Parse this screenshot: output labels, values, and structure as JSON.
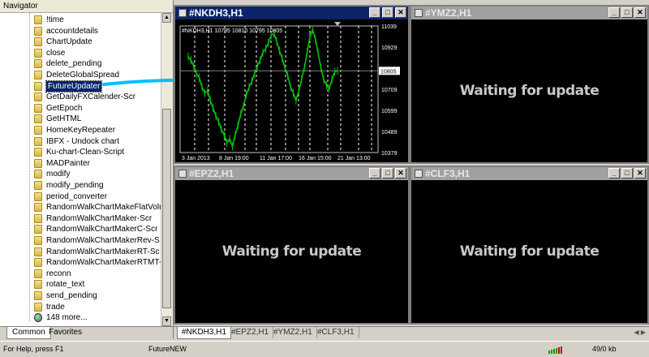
{
  "navigator": {
    "title": "Navigator",
    "items": [
      {
        "label": "!time",
        "icon": "script-icon"
      },
      {
        "label": "accountdetails",
        "icon": "script-icon"
      },
      {
        "label": "ChartUpdate",
        "icon": "script-icon"
      },
      {
        "label": "close",
        "icon": "script-icon"
      },
      {
        "label": "delete_pending",
        "icon": "script-icon"
      },
      {
        "label": "DeleteGlobalSpread",
        "icon": "script-icon"
      },
      {
        "label": "FutureUpdater",
        "icon": "script-icon",
        "selected": true
      },
      {
        "label": "GetDailyFXCalender-Scr",
        "icon": "script-icon"
      },
      {
        "label": "GetEpoch",
        "icon": "script-icon"
      },
      {
        "label": "GetHTML",
        "icon": "script-icon"
      },
      {
        "label": "HomeKeyRepeater",
        "icon": "script-icon"
      },
      {
        "label": "IBFX - Undock chart",
        "icon": "script-icon"
      },
      {
        "label": "Ku-chart-Clean-Script",
        "icon": "script-icon"
      },
      {
        "label": "MADPainter",
        "icon": "script-icon"
      },
      {
        "label": "modify",
        "icon": "script-icon"
      },
      {
        "label": "modify_pending",
        "icon": "script-icon"
      },
      {
        "label": "period_converter",
        "icon": "script-icon"
      },
      {
        "label": "RandomWalkChartMakeFlatVolu",
        "icon": "script-icon"
      },
      {
        "label": "RandomWalkChartMaker-Scr",
        "icon": "script-icon"
      },
      {
        "label": "RandomWalkChartMakerC-Scr",
        "icon": "script-icon"
      },
      {
        "label": "RandomWalkChartMakerRev-S",
        "icon": "script-icon"
      },
      {
        "label": "RandomWalkChartMakerRT-Sc",
        "icon": "script-icon"
      },
      {
        "label": "RandomWalkChartMakerRTMT-",
        "icon": "script-icon"
      },
      {
        "label": "reconn",
        "icon": "script-icon"
      },
      {
        "label": "rotate_text",
        "icon": "script-icon"
      },
      {
        "label": "send_pending",
        "icon": "script-icon"
      },
      {
        "label": "trade",
        "icon": "script-icon"
      },
      {
        "label": "148 more...",
        "icon": "globe-icon"
      }
    ],
    "tabs": [
      "Common",
      "Favorites"
    ]
  },
  "windows": {
    "nkdh": {
      "title": "#NKDH3,H1"
    },
    "ymz": {
      "title": "#YMZ2,H1",
      "waiting": "Waiting for update"
    },
    "epz": {
      "title": "#EPZ2,H1",
      "waiting": "Waiting for update"
    },
    "clf": {
      "title": "#CLF3,H1",
      "waiting": "Waiting for update"
    }
  },
  "chart_data": {
    "type": "line",
    "title": "#NKDH3,H1",
    "header_text": "#NKDH3,H1  10795 10810 10795 10805",
    "y_ticks": [
      11039,
      10929,
      10805,
      10709,
      10599,
      10489,
      10379
    ],
    "current_price": 10805,
    "ylim": [
      10379,
      11039
    ],
    "x_tick_labels": [
      "3 Jan 2013",
      "8 Jan 19:00",
      "11 Jan 17:00",
      "16 Jan 15:00",
      "21 Jan 13:00"
    ],
    "series": [
      {
        "values": [
          10880,
          10860,
          10830,
          10790,
          10770,
          10720,
          10690,
          10700,
          10650,
          10610,
          10570,
          10540,
          10500,
          10470,
          10430,
          10450,
          10410,
          10470,
          10520,
          10580,
          10620,
          10680,
          10720,
          10750,
          10790,
          10830,
          10860,
          10900,
          10920,
          10950,
          10990,
          11000,
          10960,
          10910,
          10870,
          10820,
          10780,
          10720,
          10690,
          10650,
          10700,
          10760,
          10820,
          10900,
          10980,
          11020,
          10970,
          10900,
          10820,
          10760,
          10730,
          10710,
          10760,
          10800,
          10805
        ]
      }
    ],
    "colors": {
      "candle": "#00c000",
      "grid": "#c0c0c0",
      "background": "#000000"
    }
  },
  "mdi_tabs": [
    "#NKDH3,H1",
    "#EPZ2,H1",
    "#YMZ2,H1",
    "#CLF3,H1"
  ],
  "status": {
    "help": "For Help, press F1",
    "profile": "FutureNEW",
    "traffic": "49/0 kb"
  }
}
